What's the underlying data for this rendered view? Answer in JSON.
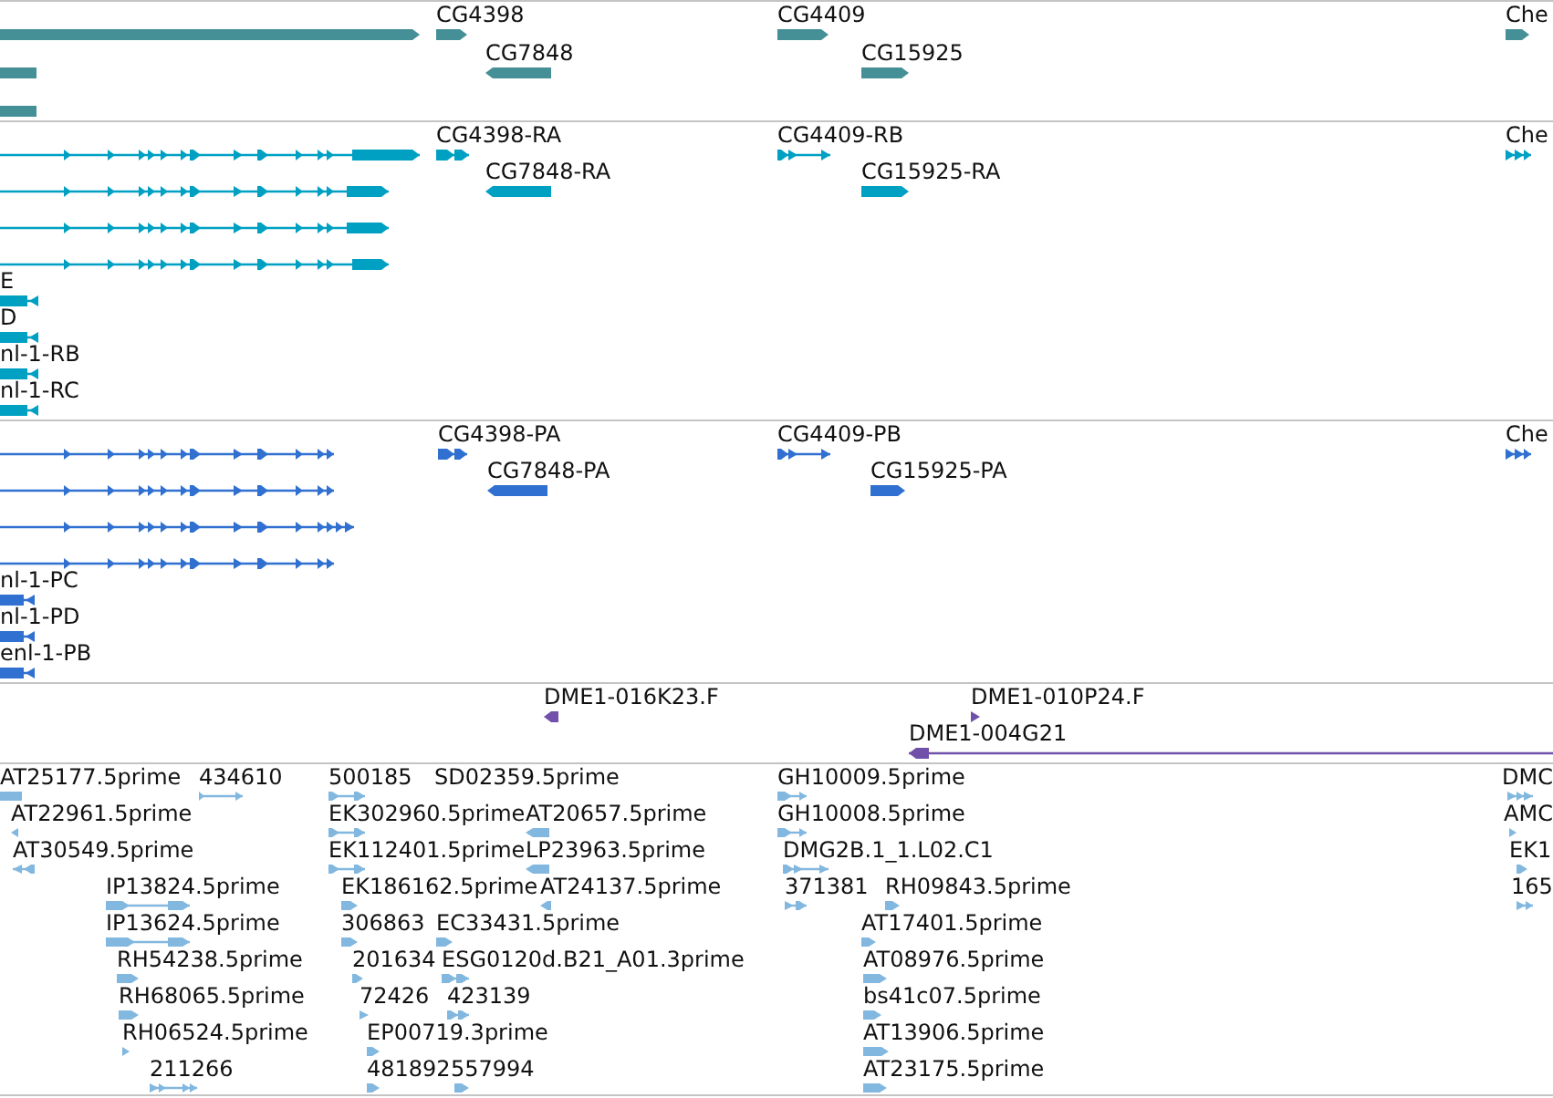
{
  "tracks": [
    {
      "color": "#458f96",
      "features": [
        {
          "reverse": false
        },
        {
          "label": "CG4398",
          "reverse": false
        },
        {
          "label": "CG4409",
          "reverse": false
        },
        {
          "label": "Che",
          "reverse": false
        },
        {
          "reverse": true
        },
        {
          "label": "CG7848",
          "reverse": true
        },
        {
          "label": "CG15925",
          "reverse": false
        },
        {
          "reverse": true
        }
      ]
    },
    {
      "color": "#00a0c3",
      "features": [
        {
          "reverse": false
        },
        {
          "label": "CG4398-RA",
          "reverse": false
        },
        {
          "label": "CG4409-RB",
          "reverse": false
        },
        {
          "label": "Che",
          "reverse": false
        },
        {
          "reverse": false
        },
        {
          "label": "CG7848-RA",
          "reverse": true
        },
        {
          "label": "CG15925-RA",
          "reverse": false
        },
        {
          "reverse": false
        },
        {
          "reverse": false
        },
        {
          "label": "E",
          "reverse": true
        },
        {
          "label": "D",
          "reverse": true
        },
        {
          "label": "nl-1-RB",
          "reverse": true
        },
        {
          "label": "nl-1-RC",
          "reverse": true
        }
      ]
    },
    {
      "color": "#3070d0",
      "features": [
        {
          "reverse": false
        },
        {
          "label": "CG4398-PA",
          "reverse": false
        },
        {
          "label": "CG4409-PB",
          "reverse": false
        },
        {
          "label": "Che",
          "reverse": false
        },
        {
          "reverse": false
        },
        {
          "label": "CG7848-PA",
          "reverse": true
        },
        {
          "label": "CG15925-PA",
          "reverse": false
        },
        {
          "reverse": false
        },
        {
          "reverse": false
        },
        {
          "label": "nl-1-PC",
          "reverse": true
        },
        {
          "label": "nl-1-PD",
          "reverse": true
        },
        {
          "label": "enl-1-PB",
          "reverse": true
        }
      ]
    },
    {
      "color": "#7050a8",
      "features": [
        {
          "label": "DME1-016K23.F",
          "reverse": true
        },
        {
          "label": "DME1-010P24.F",
          "reverse": false
        },
        {
          "label": "DME1-004G21",
          "reverse": true
        }
      ]
    },
    {
      "color": "#82b8df",
      "features": [
        {
          "label": "AT25177.5prime",
          "reverse": true
        },
        {
          "label": "434610",
          "reverse": false
        },
        {
          "label": "500185",
          "reverse": false
        },
        {
          "label": "SD02359.5prime"
        },
        {
          "label": "GH10009.5prime",
          "reverse": false
        },
        {
          "label": "DMC",
          "reverse": false
        },
        {
          "label": "AT22961.5prime",
          "reverse": true
        },
        {
          "label": "EK302960.5prime",
          "reverse": false
        },
        {
          "label": "AT20657.5prime",
          "reverse": true
        },
        {
          "label": "GH10008.5prime",
          "reverse": false
        },
        {
          "label": "AMC",
          "reverse": false
        },
        {
          "label": "AT30549.5prime",
          "reverse": true
        },
        {
          "label": "EK112401.5prime",
          "reverse": false
        },
        {
          "label": "LP23963.5prime",
          "reverse": true
        },
        {
          "label": "DMG2B.1_1.L02.C1",
          "reverse": false
        },
        {
          "label": "EK1",
          "reverse": false
        },
        {
          "label": "IP13824.5prime",
          "reverse": false
        },
        {
          "label": "EK186162.5prime",
          "reverse": false
        },
        {
          "label": "AT24137.5prime",
          "reverse": true
        },
        {
          "label": "371381",
          "reverse": false
        },
        {
          "label": "RH09843.5prime",
          "reverse": false
        },
        {
          "label": "165",
          "reverse": false
        },
        {
          "label": "IP13624.5prime",
          "reverse": false
        },
        {
          "label": "306863",
          "reverse": false
        },
        {
          "label": "EC33431.5prime",
          "reverse": false
        },
        {
          "label": "AT17401.5prime",
          "reverse": false
        },
        {
          "label": "RH54238.5prime",
          "reverse": false
        },
        {
          "label": "201634",
          "reverse": false
        },
        {
          "label": "ESG0120d.B21_A01.3prime",
          "reverse": false
        },
        {
          "label": "AT08976.5prime",
          "reverse": false
        },
        {
          "label": "RH68065.5prime",
          "reverse": false
        },
        {
          "label": "72426",
          "reverse": false
        },
        {
          "label": "423139",
          "reverse": false
        },
        {
          "label": "bs41c07.5prime",
          "reverse": false
        },
        {
          "label": "RH06524.5prime",
          "reverse": false
        },
        {
          "label": "EP00719.3prime",
          "reverse": false
        },
        {
          "label": "AT13906.5prime",
          "reverse": false
        },
        {
          "label": "211266",
          "reverse": false
        },
        {
          "label": "481892",
          "reverse": false
        },
        {
          "label": "557994",
          "reverse": false
        },
        {
          "label": "AT23175.5prime",
          "reverse": false
        }
      ]
    }
  ]
}
